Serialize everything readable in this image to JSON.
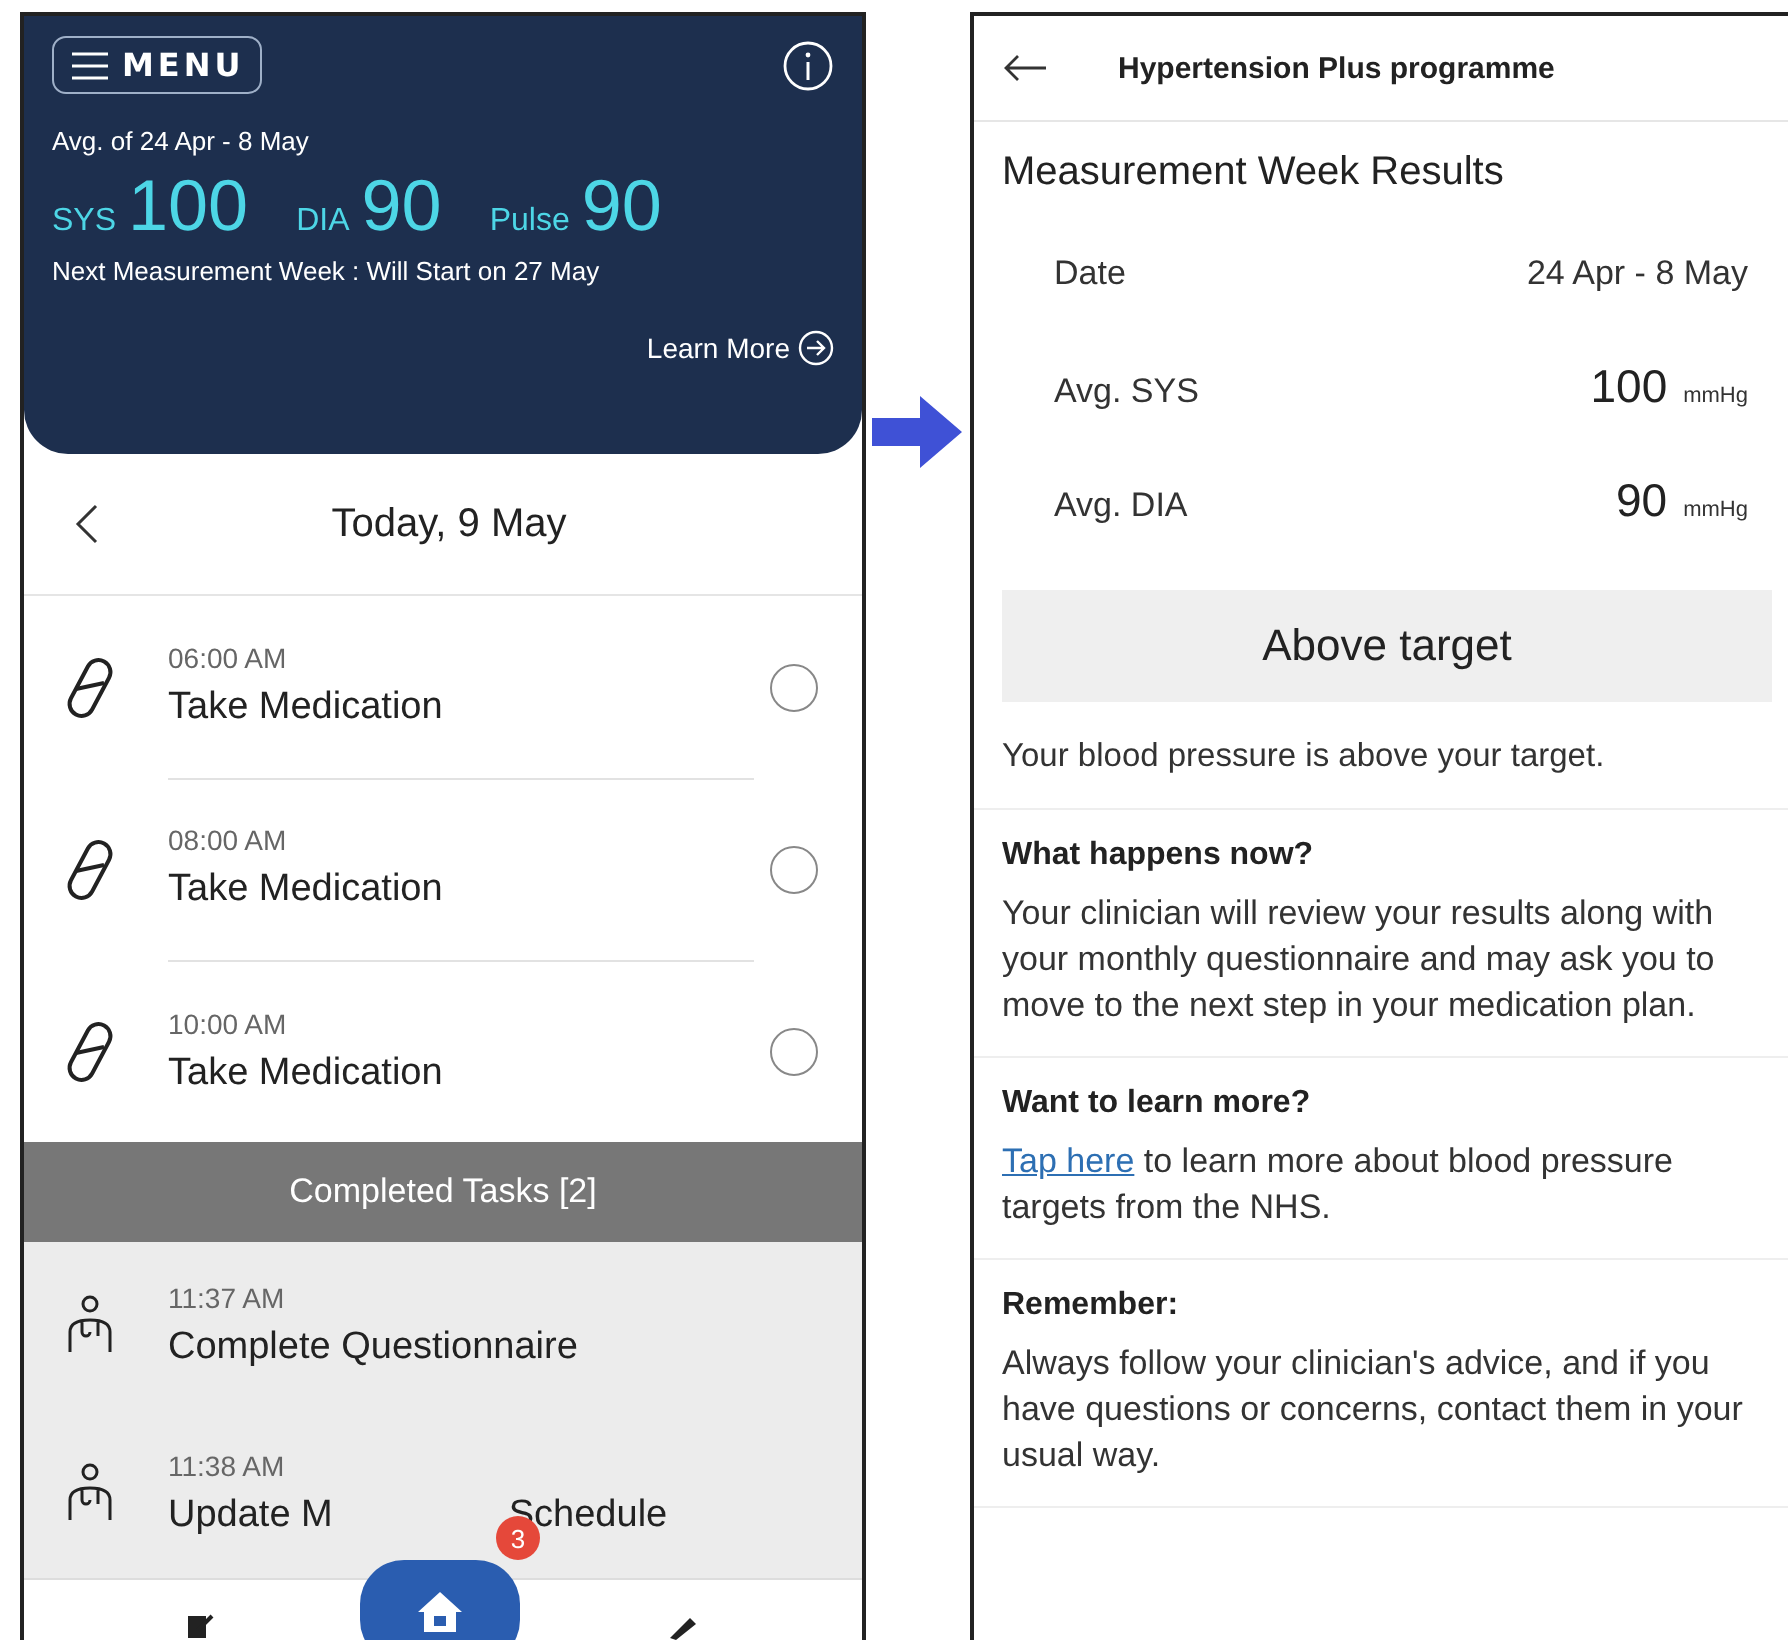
{
  "left_screen": {
    "header": {
      "menu_label": "MENU",
      "avg_label": "Avg. of 24 Apr - 8 May",
      "readings": [
        {
          "label": "SYS",
          "value": "100"
        },
        {
          "label": "DIA",
          "value": "90"
        },
        {
          "label": "Pulse",
          "value": "90"
        }
      ],
      "next_week": "Next Measurement Week : Will Start on 27 May",
      "learn_more": "Learn More"
    },
    "date_nav": {
      "title": "Today, 9 May"
    },
    "tasks": [
      {
        "time": "06:00 AM",
        "title": "Take Medication",
        "checked": false
      },
      {
        "time": "08:00 AM",
        "title": "Take Medication",
        "checked": false
      },
      {
        "time": "10:00 AM",
        "title": "Take Medication",
        "checked": false
      }
    ],
    "completed_header": "Completed Tasks [2]",
    "completed_tasks": [
      {
        "time": "11:37 AM",
        "title": "Complete Questionnaire"
      },
      {
        "time": "11:38 AM",
        "title": "Update M",
        "title_end": "Schedule"
      }
    ],
    "bottom_nav": {
      "badge": "3"
    }
  },
  "right_screen": {
    "title": "Hypertension Plus programme",
    "heading": "Measurement Week Results",
    "rows": [
      {
        "label": "Date",
        "value": "24 Apr - 8 May"
      },
      {
        "label": "Avg. SYS",
        "value": "100",
        "unit": "mmHg"
      },
      {
        "label": "Avg. DIA",
        "value": "90",
        "unit": "mmHg"
      }
    ],
    "status": "Above target",
    "status_text": "Your blood pressure is above your target.",
    "sections": [
      {
        "heading": "What happens now?",
        "text": "Your clinician will review your results along with your monthly questionnaire and may ask you to move to the next step in your medication plan."
      },
      {
        "heading": "Want to learn more?",
        "link": "Tap here",
        "text": "to learn more about blood pressure targets from the NHS."
      },
      {
        "heading": "Remember:",
        "text": "Always follow your clinician's advice, and if you have questions or concerns, contact them in your usual way."
      }
    ]
  }
}
